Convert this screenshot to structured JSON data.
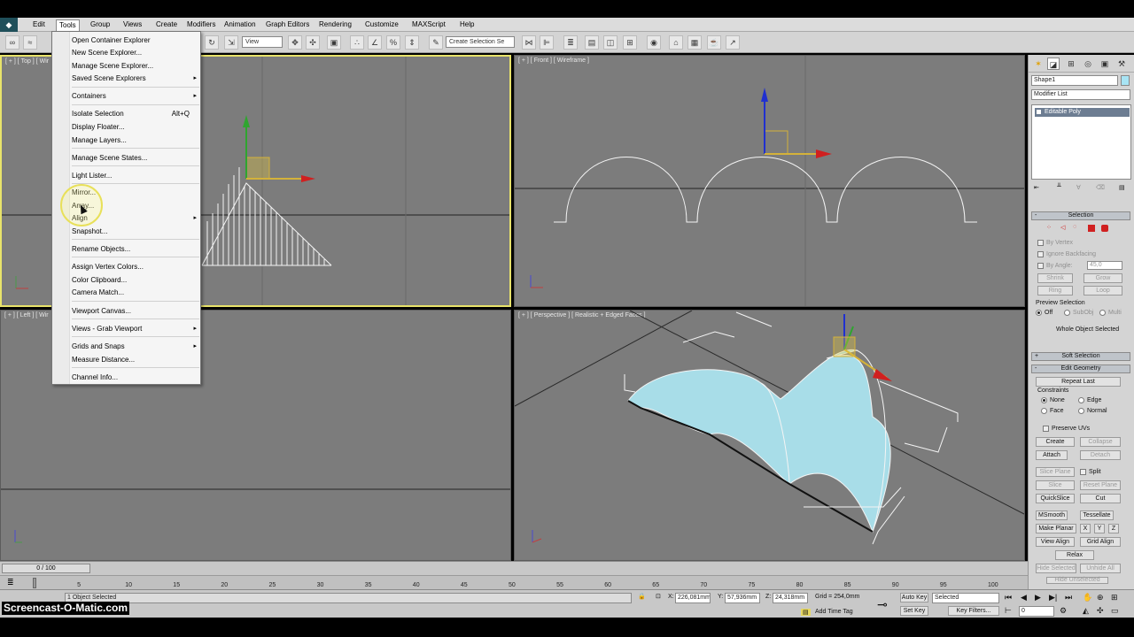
{
  "menubar": {
    "items": [
      "Edit",
      "Tools",
      "Group",
      "Views",
      "Create",
      "Modifiers",
      "Animation",
      "Graph Editors",
      "Rendering",
      "Customize",
      "MAXScript",
      "Help"
    ],
    "active": "Tools"
  },
  "toolbar": {
    "view_select": "View",
    "selection_set_placeholder": "Create Selection Se"
  },
  "tools_menu": {
    "items": [
      {
        "label": "Open Container Explorer"
      },
      {
        "label": "New Scene Explorer..."
      },
      {
        "label": "Manage Scene Explorer..."
      },
      {
        "label": "Saved Scene Explorers",
        "submenu": true
      },
      {
        "label": "Containers",
        "submenu": true
      },
      {
        "label": "Isolate Selection",
        "shortcut": "Alt+Q"
      },
      {
        "label": "Display Floater..."
      },
      {
        "label": "Manage Layers..."
      },
      {
        "label": "Manage Scene States..."
      },
      {
        "label": "Light Lister..."
      },
      {
        "label": "Mirror..."
      },
      {
        "label": "Array..."
      },
      {
        "label": "Align",
        "submenu": true
      },
      {
        "label": "Snapshot..."
      },
      {
        "label": "Rename Objects..."
      },
      {
        "label": "Assign Vertex Colors..."
      },
      {
        "label": "Color Clipboard..."
      },
      {
        "label": "Camera Match..."
      },
      {
        "label": "Viewport Canvas..."
      },
      {
        "label": "Views - Grab Viewport",
        "submenu": true
      },
      {
        "label": "Grids and Snaps",
        "submenu": true
      },
      {
        "label": "Measure Distance..."
      },
      {
        "label": "Channel Info..."
      }
    ]
  },
  "viewports": {
    "top": "[ + ] [ Top ] [ Wir",
    "front": "[ + ] [ Front ] [ Wireframe ]",
    "left": "[ + ] [ Left ] [ Wir",
    "perspective": "[ + ] [ Perspective ] [ Realistic + Edged Faces ]"
  },
  "command_panel": {
    "object_name": "Shape1",
    "modifier_list": "Modifier List",
    "stack_item": "Editable Poly",
    "selection": {
      "title": "Selection",
      "by_vertex": "By Vertex",
      "ignore_backfacing": "Ignore Backfacing",
      "by_angle": "By Angle:",
      "angle_value": "45,0",
      "shrink": "Shrink",
      "grow": "Grow",
      "ring": "Ring",
      "loop": "Loop",
      "preview_selection": "Preview Selection",
      "preview_off": "Off",
      "preview_subobj": "SubObj",
      "preview_multi": "Multi",
      "status": "Whole Object Selected"
    },
    "soft_selection": "Soft Selection",
    "edit_geometry": {
      "title": "Edit Geometry",
      "repeat_last": "Repeat Last",
      "constraints": "Constraints",
      "none": "None",
      "edge": "Edge",
      "face": "Face",
      "normal": "Normal",
      "preserve_uvs": "Preserve UVs",
      "create": "Create",
      "collapse": "Collapse",
      "attach": "Attach",
      "detach": "Detach",
      "slice_plane": "Slice Plane",
      "split": "Split",
      "slice": "Slice",
      "reset_plane": "Reset Plane",
      "quickslice": "QuickSlice",
      "cut": "Cut",
      "msmooth": "MSmooth",
      "tessellate": "Tessellate",
      "make_planar": "Make Planar",
      "x": "X",
      "y": "Y",
      "z": "Z",
      "view_align": "View Align",
      "grid_align": "Grid Align",
      "relax": "Relax",
      "hide_selected": "Hide Selected",
      "unhide_all": "Unhide All",
      "hide_unselected": "Hide Unselected"
    }
  },
  "timeline": {
    "slider": "0 / 100",
    "ticks": [
      "5",
      "10",
      "15",
      "20",
      "25",
      "30",
      "35",
      "40",
      "45",
      "50",
      "55",
      "60",
      "65",
      "70",
      "75",
      "80",
      "85",
      "90",
      "95",
      "100"
    ]
  },
  "status": {
    "selected": "1 Object Selected",
    "x_label": "X:",
    "x": "226,081mm",
    "y_label": "Y:",
    "y": "57,936mm",
    "z_label": "Z:",
    "z": "24,318mm",
    "grid": "Grid = 254,0mm",
    "add_time_tag": "Add Time Tag",
    "auto_key": "Auto Key",
    "set_key": "Set Key",
    "key_mode": "Selected",
    "key_filters": "Key Filters...",
    "frame": "0"
  },
  "watermark": "Screencast-O-Matic.com"
}
